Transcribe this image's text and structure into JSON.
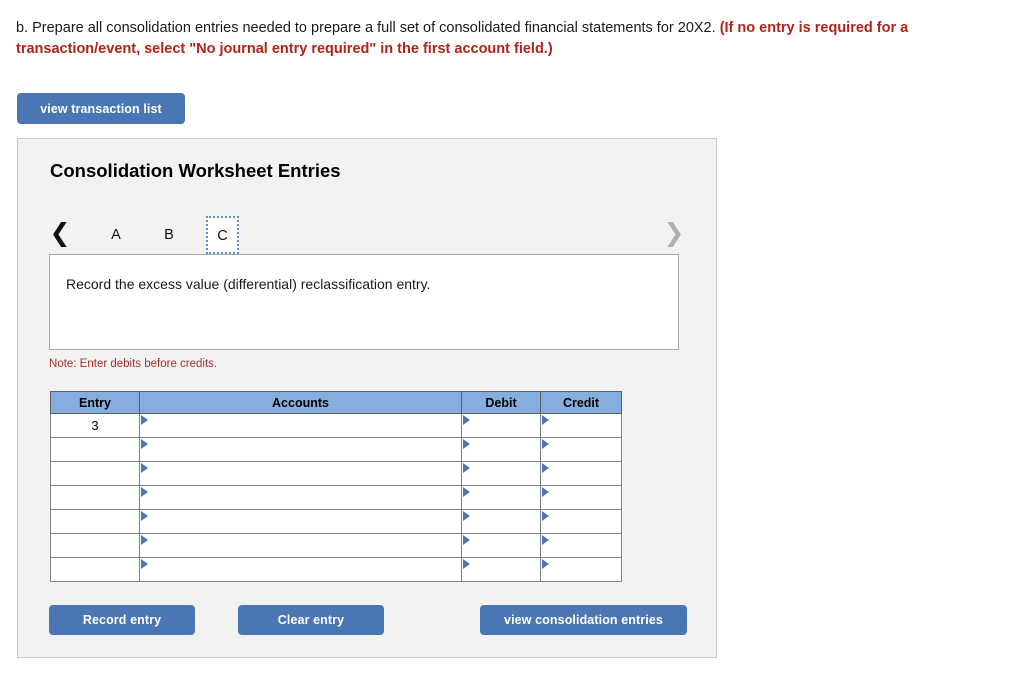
{
  "prompt": {
    "main": "b. Prepare all consolidation entries needed to prepare a full set of consolidated financial statements for 20X2.",
    "highlight": "(If no entry is required for a transaction/event, select \"No journal entry required\" in the first account field.)"
  },
  "toolbar": {
    "view_transaction_list_label": "view transaction list"
  },
  "panel": {
    "title": "Consolidation Worksheet Entries"
  },
  "tabs": {
    "prev_icon": "chevron-left-icon",
    "next_icon": "chevron-right-icon",
    "items": [
      {
        "label": "A",
        "selected": false
      },
      {
        "label": "B",
        "selected": false
      },
      {
        "label": "C",
        "selected": true
      }
    ]
  },
  "description": {
    "text": "Record the excess value (differential) reclassification entry."
  },
  "note": {
    "text": "Note: Enter debits before credits."
  },
  "journal": {
    "columns": [
      "Entry",
      "Accounts",
      "Debit",
      "Credit"
    ],
    "rows": [
      {
        "entry": "3",
        "accounts": "",
        "debit": "",
        "credit": ""
      },
      {
        "entry": "",
        "accounts": "",
        "debit": "",
        "credit": ""
      },
      {
        "entry": "",
        "accounts": "",
        "debit": "",
        "credit": ""
      },
      {
        "entry": "",
        "accounts": "",
        "debit": "",
        "credit": ""
      },
      {
        "entry": "",
        "accounts": "",
        "debit": "",
        "credit": ""
      },
      {
        "entry": "",
        "accounts": "",
        "debit": "",
        "credit": ""
      },
      {
        "entry": "",
        "accounts": "",
        "debit": "",
        "credit": ""
      }
    ]
  },
  "actions": {
    "record_entry_label": "Record entry",
    "clear_entry_label": "Clear entry",
    "view_consolidation_entries_label": "view consolidation entries"
  },
  "colors": {
    "button_blue": "#4a77b4",
    "table_header_blue": "#85aede",
    "alert_red": "#b02418",
    "note_red": "#a4312a",
    "panel_gray": "#f2f2f2"
  }
}
